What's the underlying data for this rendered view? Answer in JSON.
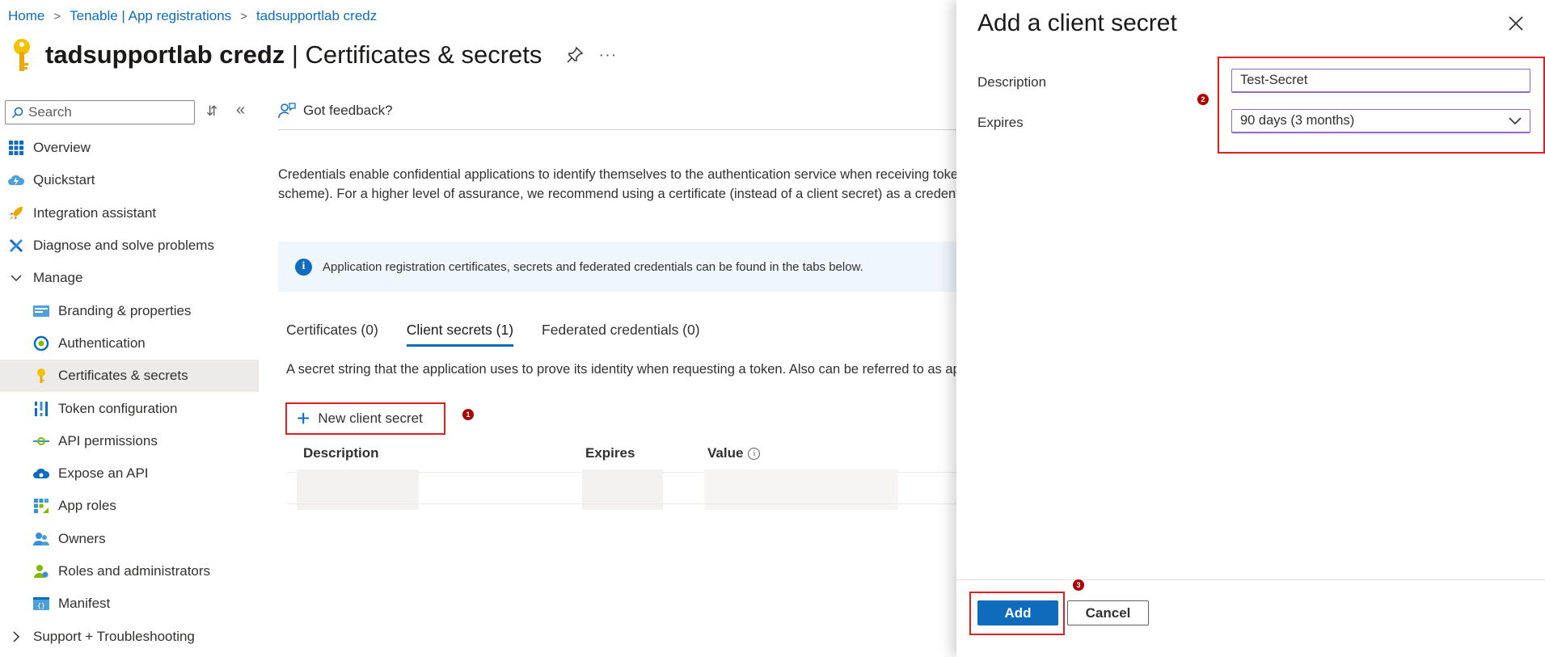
{
  "breadcrumb": {
    "items": [
      "Home",
      "Tenable | App registrations",
      "tadsupportlab credz"
    ]
  },
  "header": {
    "app_name": "tadsupportlab credz",
    "separator": " | ",
    "page_name": "Certificates & secrets",
    "more_label": "···"
  },
  "sidebar": {
    "search_placeholder": "Search",
    "items": [
      {
        "label": "Overview",
        "icon": "overview-grid-icon"
      },
      {
        "label": "Quickstart",
        "icon": "cloud-lightning-icon"
      },
      {
        "label": "Integration assistant",
        "icon": "rocket-icon"
      },
      {
        "label": "Diagnose and solve problems",
        "icon": "wrench-icon"
      },
      {
        "label": "Manage",
        "icon": "chevron-down-icon"
      },
      {
        "label": "Branding & properties",
        "icon": "card-icon"
      },
      {
        "label": "Authentication",
        "icon": "auth-refresh-icon"
      },
      {
        "label": "Certificates & secrets",
        "icon": "key-icon"
      },
      {
        "label": "Token configuration",
        "icon": "token-bars-icon"
      },
      {
        "label": "API permissions",
        "icon": "api-arrow-icon"
      },
      {
        "label": "Expose an API",
        "icon": "cloud-api-icon"
      },
      {
        "label": "App roles",
        "icon": "app-roles-grid-icon"
      },
      {
        "label": "Owners",
        "icon": "people-icon"
      },
      {
        "label": "Roles and administrators",
        "icon": "admin-person-icon"
      },
      {
        "label": "Manifest",
        "icon": "manifest-icon"
      },
      {
        "label": "Support + Troubleshooting",
        "icon": "chevron-right-icon"
      }
    ]
  },
  "main": {
    "feedback_label": "Got feedback?",
    "intro_line1": "Credentials enable confidential applications to identify themselves to the authentication service when receiving toker",
    "intro_line2": "scheme). For a higher level of assurance, we recommend using a certificate (instead of a client secret) as a credential.",
    "info_text": "Application registration certificates, secrets and federated credentials can be found in the tabs below.",
    "tabs": [
      "Certificates (0)",
      "Client secrets (1)",
      "Federated credentials (0)"
    ],
    "tab_description": "A secret string that the application uses to prove its identity when requesting a token. Also can be referred to as ap",
    "new_secret_label": "New client secret",
    "table_headers": [
      "Description",
      "Expires",
      "Value"
    ]
  },
  "steps": [
    "1",
    "2",
    "3"
  ],
  "panel": {
    "title": "Add a client secret",
    "description_label": "Description",
    "description_value": "Test-Secret",
    "expires_label": "Expires",
    "expires_value": "90 days (3 months)",
    "add_label": "Add",
    "cancel_label": "Cancel"
  },
  "colors": {
    "accent": "#0f6cbd",
    "highlight_box": "#e02020",
    "step_badge": "#a80000",
    "info_bar": "#eff6fc"
  }
}
